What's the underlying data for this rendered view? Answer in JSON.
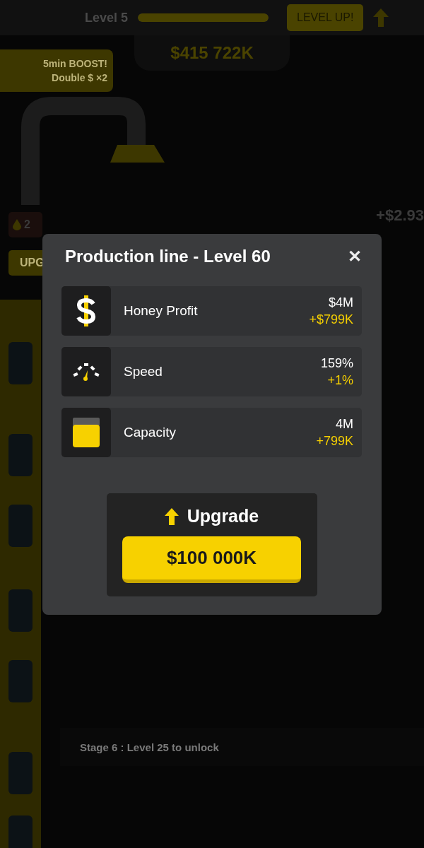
{
  "top_bar": {
    "level_label": "Level 5",
    "level_progress": {
      "level": 1
    },
    "level_up_button": "LEVEL UP!",
    "money": "$415 722K"
  },
  "boost": {
    "title": "5min BOOST!",
    "subtitle": "Double $ ×2"
  },
  "income_popup": "+$2.93",
  "station": {
    "stock": "2",
    "upgrade_button": "UPG"
  },
  "locked_stage": "Stage 6 : Level 25 to unlock",
  "dialog": {
    "title": "Production line - Level 60",
    "close": "✕",
    "stats": [
      {
        "kind": "money",
        "label": "Honey Profit",
        "value": "$4M",
        "increase": "+$799K"
      },
      {
        "kind": "speed",
        "label": "Speed",
        "value": "159%",
        "increase": "+1%"
      },
      {
        "kind": "capacity",
        "label": "Capacity",
        "value": "4M",
        "increase": "+799K"
      }
    ],
    "upgrade": {
      "title": "Upgrade",
      "price": "$100 000K"
    }
  }
}
